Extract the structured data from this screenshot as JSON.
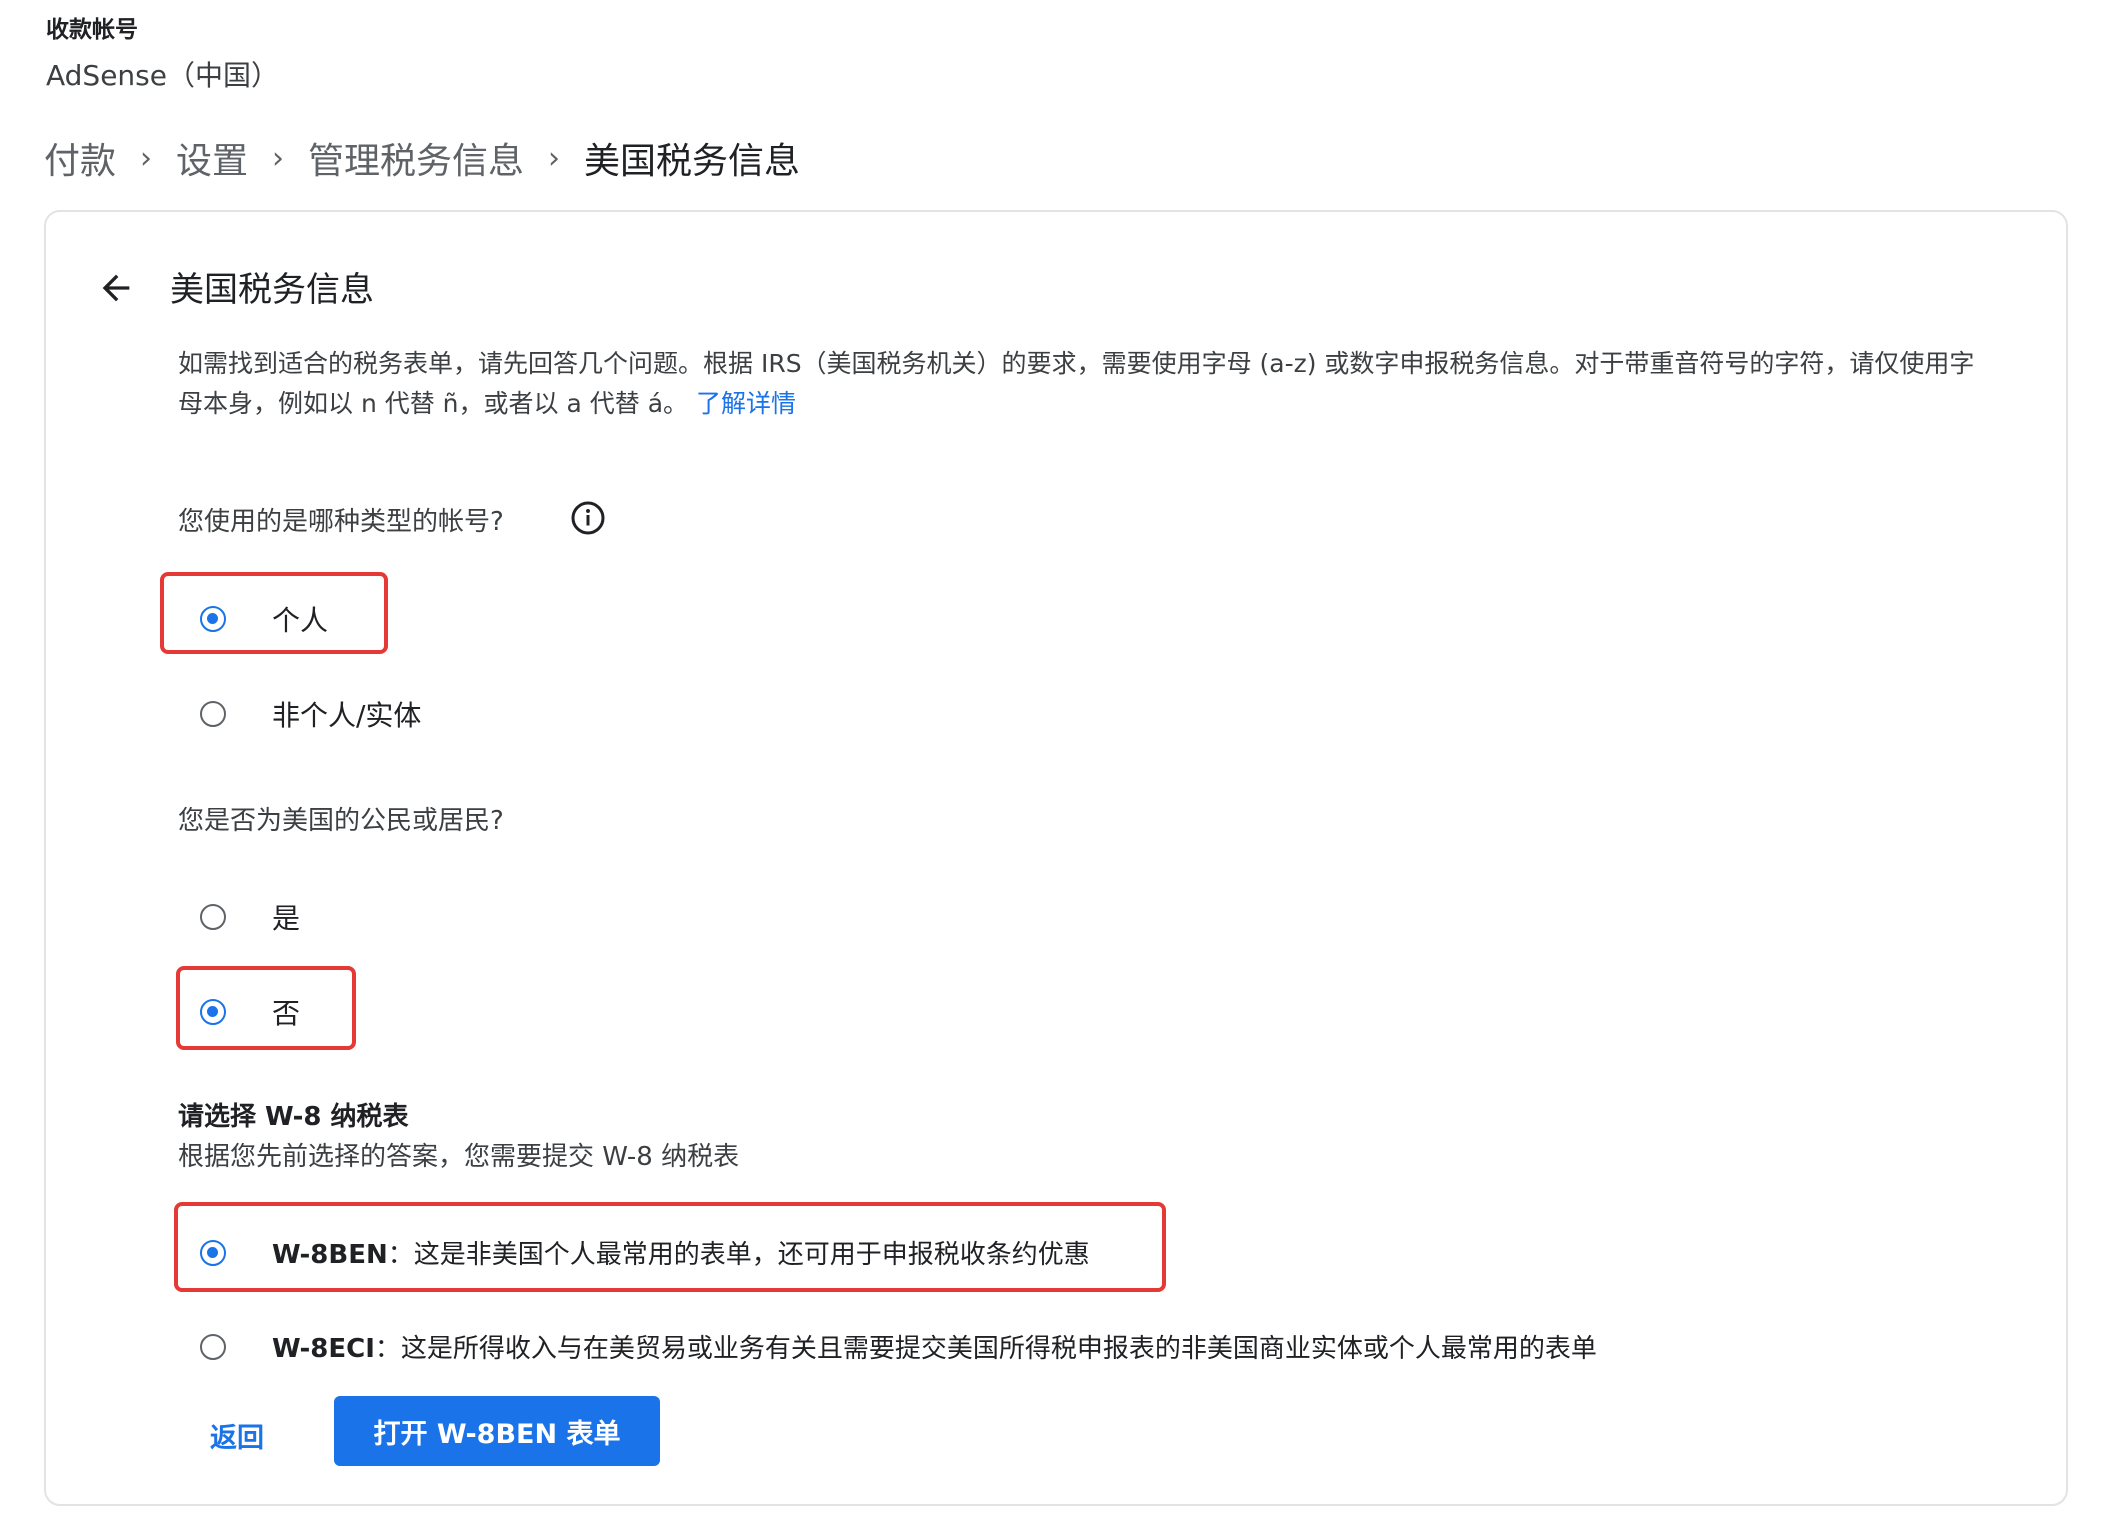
{
  "account": {
    "label": "收款帐号",
    "value": "AdSense（中国）"
  },
  "breadcrumb": [
    "付款",
    "设置",
    "管理税务信息",
    "美国税务信息"
  ],
  "card": {
    "title": "美国税务信息",
    "description": "如需找到适合的税务表单，请先回答几个问题。根据 IRS（美国税务机关）的要求，需要使用字母 (a-z) 或数字申报税务信息。对于带重音符号的字符，请仅使用字母本身，例如以 n 代替 ñ，或者以 a 代替 á。",
    "learn_more": "了解详情"
  },
  "questions": {
    "account_type": {
      "label": "您使用的是哪种类型的帐号?",
      "options": [
        {
          "label": "个人",
          "checked": true
        },
        {
          "label": "非个人/实体",
          "checked": false
        }
      ]
    },
    "us_citizen": {
      "label": "您是否为美国的公民或居民?",
      "options": [
        {
          "label": "是",
          "checked": false
        },
        {
          "label": "否",
          "checked": true
        }
      ]
    }
  },
  "w8": {
    "title": "请选择 W-8 纳税表",
    "subtitle": "根据您先前选择的答案，您需要提交 W-8 纳税表",
    "options": [
      {
        "code": "W-8BEN",
        "desc": "：这是非美国个人最常用的表单，还可用于申报税收条约优惠",
        "checked": true
      },
      {
        "code": "W-8ECI",
        "desc": "：这是所得收入与在美贸易或业务有关且需要提交美国所得税申报表的非美国商业实体或个人最常用的表单",
        "checked": false
      }
    ]
  },
  "actions": {
    "back": "返回",
    "primary": "打开 W-8BEN 表单"
  },
  "colors": {
    "accent": "#1a73e8",
    "highlight": "#e53935"
  },
  "icons": {
    "back": "arrow-left-icon",
    "info": "info-circle-icon",
    "breadcrumb_separator": "chevron-right-icon"
  }
}
